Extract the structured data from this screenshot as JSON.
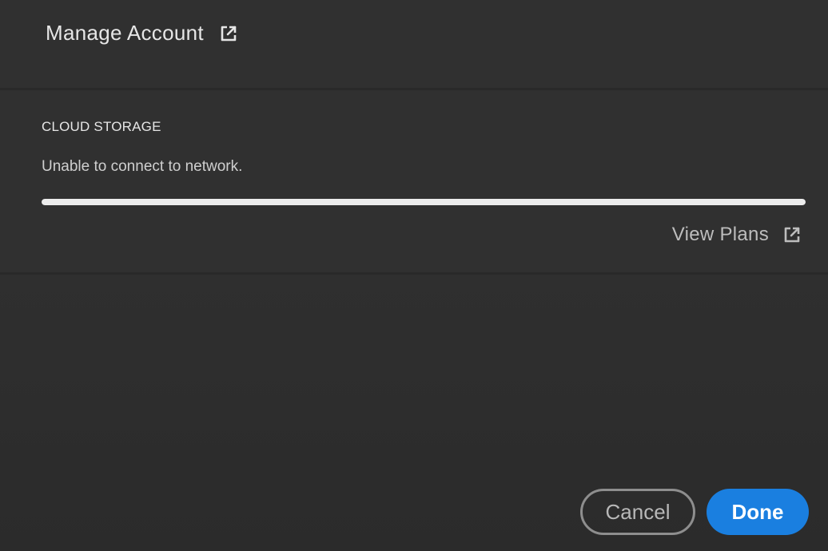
{
  "account": {
    "manage_label": "Manage Account",
    "manage_icon": "external-link-icon"
  },
  "storage": {
    "heading": "CLOUD STORAGE",
    "status": "Unable to connect to network.",
    "usage_fraction": 1.0,
    "view_plans_label": "View Plans",
    "view_plans_icon": "external-link-icon"
  },
  "footer": {
    "cancel_label": "Cancel",
    "done_label": "Done"
  },
  "colors": {
    "background": "#2f2f2f",
    "accent": "#1a7fe0",
    "progress_fill": "#ececec"
  }
}
